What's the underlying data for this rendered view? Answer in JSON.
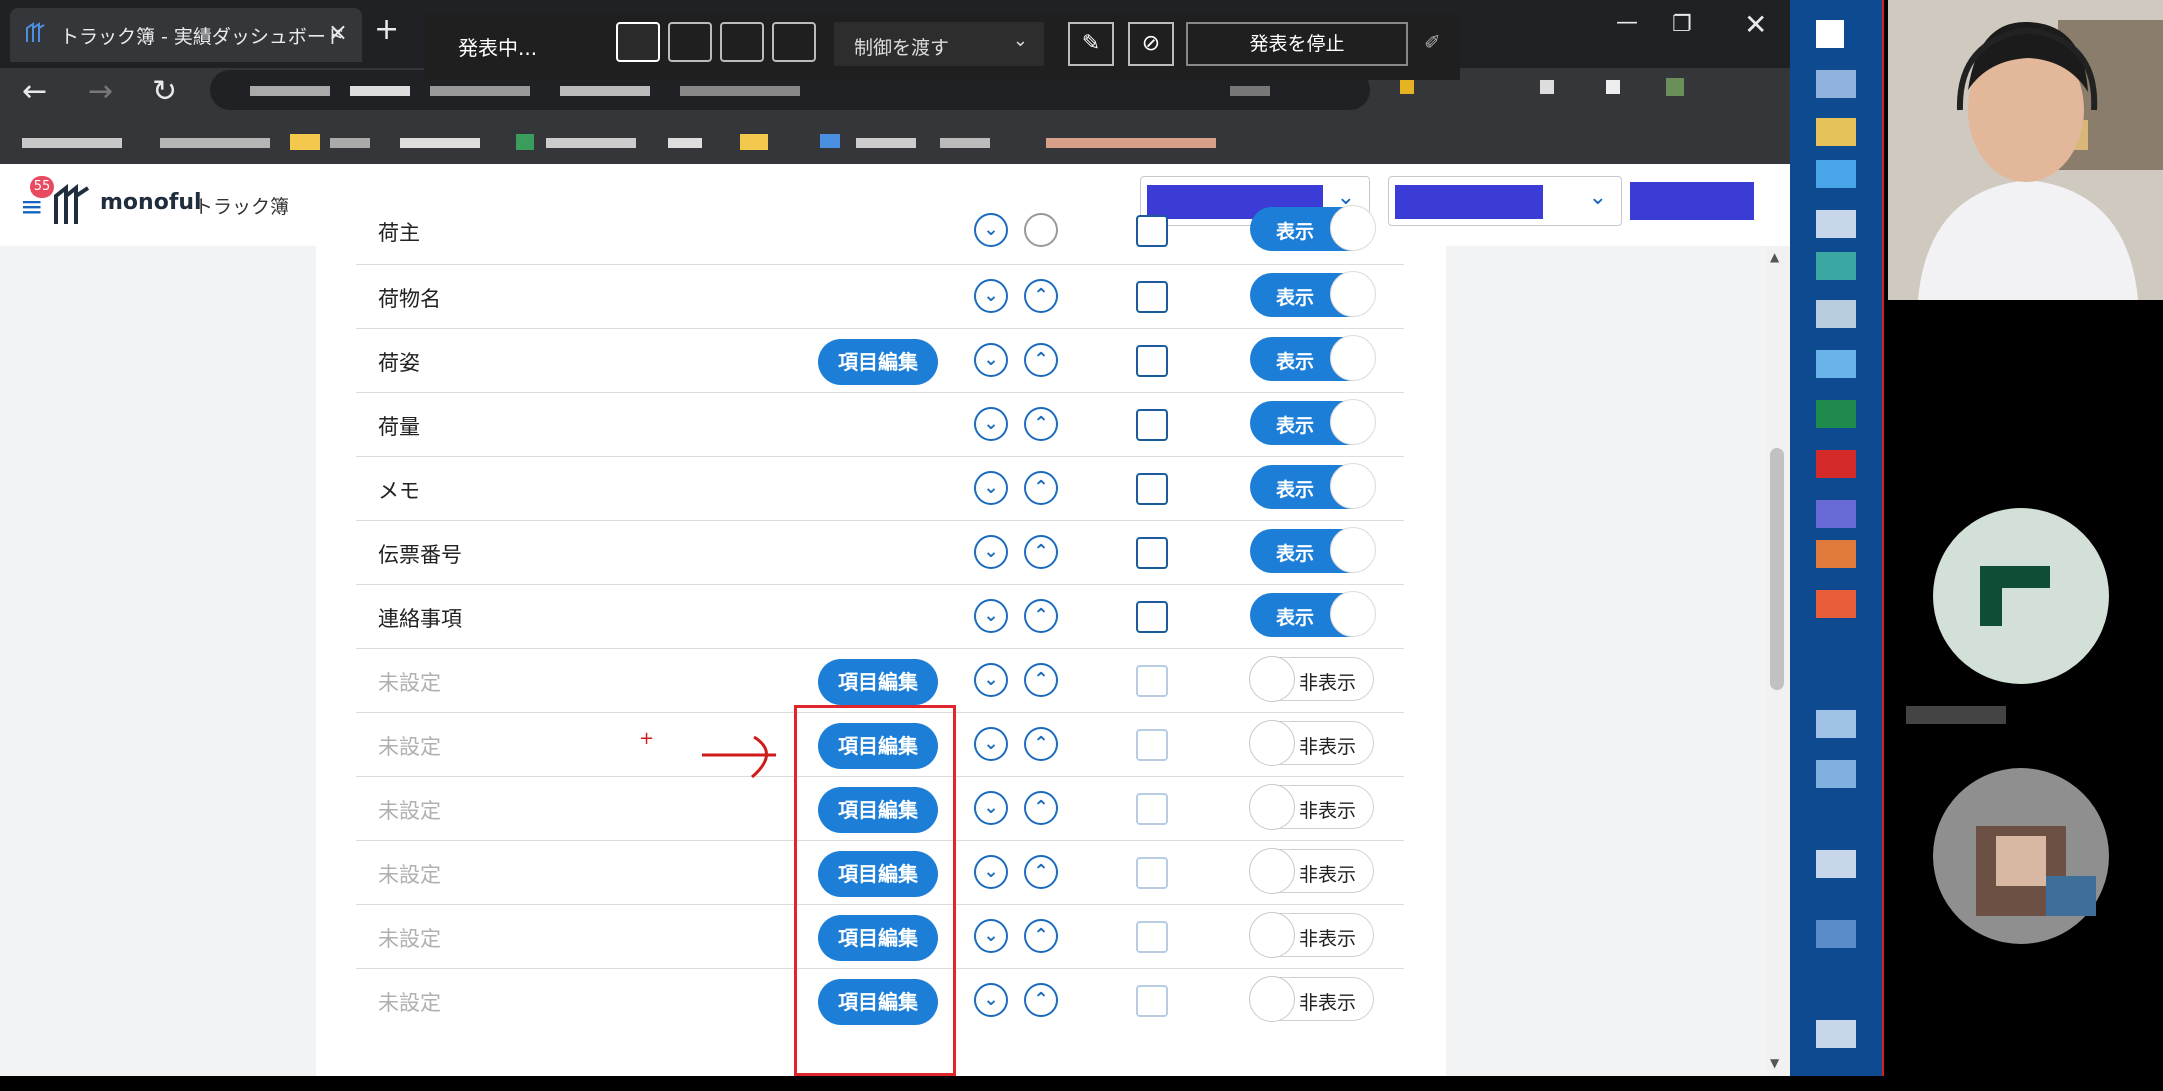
{
  "browser": {
    "tab_title": "トラック簿 - 実績ダッシュボード",
    "tab_close": "×",
    "new_tab": "+"
  },
  "meeting": {
    "status": "発表中...",
    "control_label": "制御を渡す",
    "stop_label": "発表を停止"
  },
  "app": {
    "badge": "55",
    "brand": "monoful",
    "brand_sub": "トラック簿"
  },
  "labels": {
    "edit": "項目編集",
    "show": "表示",
    "hide": "非表示"
  },
  "rows": [
    {
      "label": "荷主",
      "edit": false,
      "shown": true
    },
    {
      "label": "荷物名",
      "edit": false,
      "shown": true
    },
    {
      "label": "荷姿",
      "edit": true,
      "shown": true
    },
    {
      "label": "荷量",
      "edit": false,
      "shown": true
    },
    {
      "label": "メモ",
      "edit": false,
      "shown": true
    },
    {
      "label": "伝票番号",
      "edit": false,
      "shown": true
    },
    {
      "label": "連絡事項",
      "edit": false,
      "shown": true
    },
    {
      "label": "未設定",
      "edit": true,
      "shown": false
    },
    {
      "label": "未設定",
      "edit": true,
      "shown": false
    },
    {
      "label": "未設定",
      "edit": true,
      "shown": false
    },
    {
      "label": "未設定",
      "edit": true,
      "shown": false
    },
    {
      "label": "未設定",
      "edit": true,
      "shown": false
    },
    {
      "label": "未設定",
      "edit": true,
      "shown": false
    }
  ],
  "icons": {
    "favicon": "monoful-logo-icon",
    "down": "chevron-down-circle-icon",
    "up": "chevron-up-circle-icon",
    "menu": "hamburger-menu-icon"
  },
  "colors": {
    "accent": "#1c7ed6",
    "highlight": "#e0262d",
    "select_fill": "#3b3bd6",
    "taskbar": "#0d4a8f"
  }
}
